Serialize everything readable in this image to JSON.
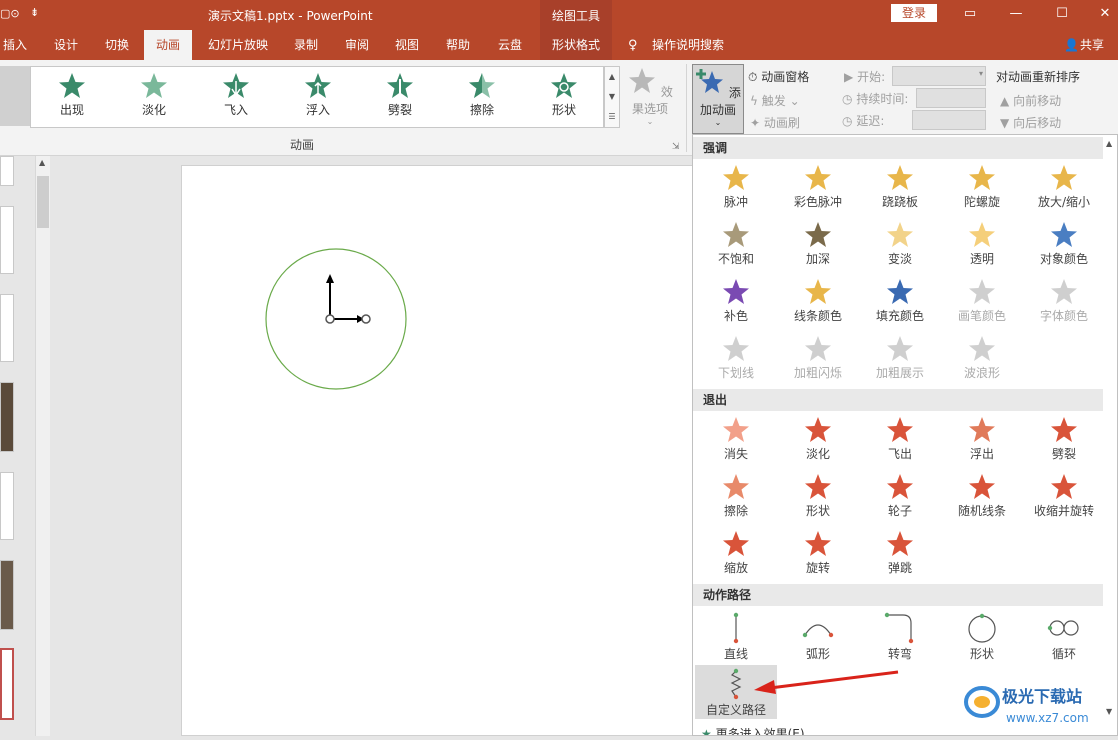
{
  "titlebar": {
    "quick_access": "▢⊙",
    "qat_more": "⇟",
    "doc_title": "演示文稿1.pptx - PowerPoint",
    "context_tool": "绘图工具",
    "login": "登录",
    "win_restore": "▭",
    "win_min": "—",
    "win_max": "☐",
    "win_close": "✕"
  },
  "tabs": [
    "插入",
    "设计",
    "切换",
    "动画",
    "幻灯片放映",
    "录制",
    "审阅",
    "视图",
    "帮助",
    "云盘",
    "形状格式"
  ],
  "active_tab": "动画",
  "tell_me": "操作说明搜索",
  "share": "共享",
  "ribbon": {
    "animations": [
      "出现",
      "淡化",
      "飞入",
      "浮入",
      "劈裂",
      "擦除",
      "形状"
    ],
    "effect_options": "效果选项",
    "group_label": "动画",
    "add_animation": "添加动画",
    "animation_pane": "动画窗格",
    "trigger": "触发",
    "painter": "动画刷",
    "start": "开始:",
    "duration": "持续时间:",
    "delay": "延迟:",
    "reorder": "对动画重新排序",
    "move_earlier": "向前移动",
    "move_later": "向后移动"
  },
  "dropdown": {
    "emphasis_header": "强调",
    "emphasis": [
      {
        "label": "脉冲",
        "color": "#e8b64a",
        "dim": false
      },
      {
        "label": "彩色脉冲",
        "color": "#e8b64a",
        "dim": false
      },
      {
        "label": "跷跷板",
        "color": "#e8b64a",
        "dim": false
      },
      {
        "label": "陀螺旋",
        "color": "#e8b64a",
        "dim": false
      },
      {
        "label": "放大/缩小",
        "color": "#e8b64a",
        "dim": false
      },
      {
        "label": "不饱和",
        "color": "#a89a7a",
        "dim": false
      },
      {
        "label": "加深",
        "color": "#7a6a4a",
        "dim": false
      },
      {
        "label": "变淡",
        "color": "#f2d38a",
        "dim": false
      },
      {
        "label": "透明",
        "color": "#f5cf7a",
        "dim": false
      },
      {
        "label": "对象颜色",
        "color": "#4a7ec2",
        "dim": false
      },
      {
        "label": "补色",
        "color": "#7a4ab2",
        "dim": false
      },
      {
        "label": "线条颜色",
        "color": "#e8b64a",
        "dim": false
      },
      {
        "label": "填充颜色",
        "color": "#3a6ab2",
        "dim": false
      },
      {
        "label": "画笔颜色",
        "color": "#cfcfcf",
        "dim": true
      },
      {
        "label": "字体颜色",
        "color": "#cfcfcf",
        "dim": true
      },
      {
        "label": "下划线",
        "color": "#cfcfcf",
        "dim": true
      },
      {
        "label": "加粗闪烁",
        "color": "#cfcfcf",
        "dim": true
      },
      {
        "label": "加粗展示",
        "color": "#cfcfcf",
        "dim": true
      },
      {
        "label": "波浪形",
        "color": "#cfcfcf",
        "dim": true
      }
    ],
    "exit_header": "退出",
    "exit": [
      {
        "label": "消失",
        "color": "#f2a08a"
      },
      {
        "label": "淡化",
        "color": "#d9543a"
      },
      {
        "label": "飞出",
        "color": "#d9543a"
      },
      {
        "label": "浮出",
        "color": "#e07a5a"
      },
      {
        "label": "劈裂",
        "color": "#d9543a"
      },
      {
        "label": "擦除",
        "color": "#e88a6a"
      },
      {
        "label": "形状",
        "color": "#d9543a"
      },
      {
        "label": "轮子",
        "color": "#d9543a"
      },
      {
        "label": "随机线条",
        "color": "#d9543a"
      },
      {
        "label": "收缩并旋转",
        "color": "#d9543a"
      },
      {
        "label": "缩放",
        "color": "#d9543a"
      },
      {
        "label": "旋转",
        "color": "#d9543a"
      },
      {
        "label": "弹跳",
        "color": "#d9543a"
      }
    ],
    "path_header": "动作路径",
    "paths": [
      "直线",
      "弧形",
      "转弯",
      "形状",
      "循环",
      "自定义路径"
    ],
    "more_effects": "更多进入效果(E)..."
  },
  "watermark": {
    "brand": "极光下载站",
    "url": "www.xz7.com"
  }
}
